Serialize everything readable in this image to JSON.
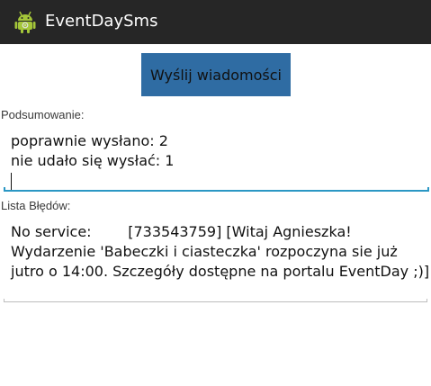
{
  "app": {
    "title": "EventDaySms",
    "icon": "android-icon",
    "accent_color": "#2f6ca3",
    "focus_color": "#2b97c4"
  },
  "main": {
    "send_button_label": "Wyślij wiadomości",
    "summary": {
      "label": "Podsumowanie:",
      "lines": [
        "poprawnie wysłano: 2",
        "nie udało się wysłać: 1"
      ]
    },
    "errors": {
      "label": "Lista Błędów:",
      "lines": [
        "No service:        [733543759] [Witaj Agnieszka!",
        "Wydarzenie 'Babeczki i ciasteczka' rozpoczyna sie już",
        "jutro o 14:00. Szczegóły dostępne na portalu EventDay ;)]"
      ]
    }
  }
}
